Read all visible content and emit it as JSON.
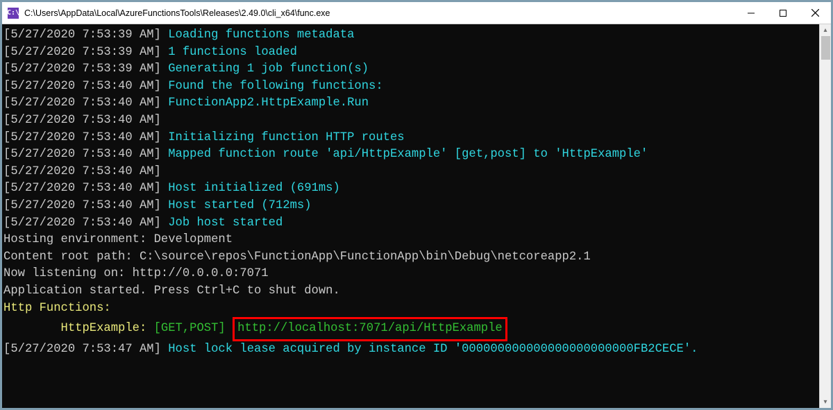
{
  "window": {
    "title": "C:\\Users\\AppData\\Local\\AzureFunctionsTools\\Releases\\2.49.0\\cli_x64\\func.exe",
    "icon_glyph": "C:\\"
  },
  "log": {
    "lines": [
      {
        "ts": "[5/27/2020 7:53:39 AM]",
        "body": "Loading functions metadata",
        "style": "msg"
      },
      {
        "ts": "[5/27/2020 7:53:39 AM]",
        "body": "1 functions loaded",
        "style": "msg"
      },
      {
        "ts": "[5/27/2020 7:53:39 AM]",
        "body": "Generating 1 job function(s)",
        "style": "msg"
      },
      {
        "ts": "[5/27/2020 7:53:40 AM]",
        "body": "Found the following functions:",
        "style": "msg"
      },
      {
        "ts": "[5/27/2020 7:53:40 AM]",
        "body": "FunctionApp2.HttpExample.Run",
        "style": "msg"
      },
      {
        "ts": "[5/27/2020 7:53:40 AM]",
        "body": "",
        "style": "msg"
      },
      {
        "ts": "[5/27/2020 7:53:40 AM]",
        "body": "Initializing function HTTP routes",
        "style": "msg"
      },
      {
        "ts": "[5/27/2020 7:53:40 AM]",
        "body": "Mapped function route 'api/HttpExample' [get,post] to 'HttpExample'",
        "style": "msg"
      },
      {
        "ts": "[5/27/2020 7:53:40 AM]",
        "body": "",
        "style": "msg"
      },
      {
        "ts": "[5/27/2020 7:53:40 AM]",
        "body": "Host initialized (691ms)",
        "style": "msg"
      },
      {
        "ts": "[5/27/2020 7:53:40 AM]",
        "body": "Host started (712ms)",
        "style": "msg"
      },
      {
        "ts": "[5/27/2020 7:53:40 AM]",
        "body": "Job host started",
        "style": "msg"
      }
    ],
    "plain": [
      "Hosting environment: Development",
      "Content root path: C:\\source\\repos\\FunctionApp\\FunctionApp\\bin\\Debug\\netcoreapp2.1",
      "Now listening on: http://0.0.0.0:7071",
      "Application started. Press Ctrl+C to shut down.",
      ""
    ],
    "header": "Http Functions:",
    "func": {
      "indent": "        ",
      "name": "HttpExample:",
      "methods": "[GET,POST]",
      "url": "http://localhost:7071/api/HttpExample"
    },
    "tail": {
      "ts": "[5/27/2020 7:53:47 AM]",
      "body": "Host lock lease acquired by instance ID '000000000000000000000000FB2CECE'."
    }
  }
}
